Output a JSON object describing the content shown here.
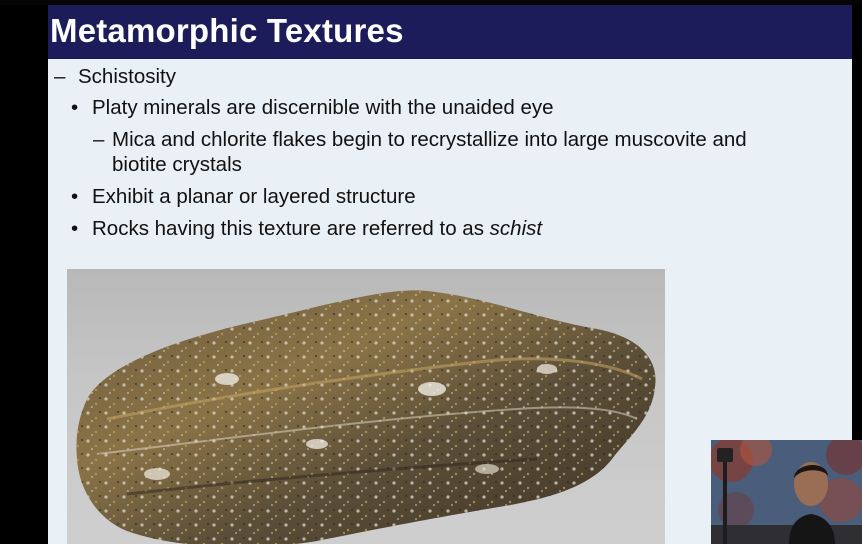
{
  "slide": {
    "title": "Metamorphic Textures",
    "outline": [
      {
        "level": 1,
        "marker": "–",
        "text": "Schistosity"
      },
      {
        "level": 2,
        "marker": "•",
        "text": "Platy minerals are discernible with the unaided eye"
      },
      {
        "level": 3,
        "marker": "–",
        "text": "Mica and chlorite flakes begin to recrystallize into large muscovite and"
      },
      {
        "level": 3,
        "marker": "",
        "text": "biotite crystals"
      },
      {
        "level": 2,
        "marker": "•",
        "text": "Exhibit a planar or layered structure"
      },
      {
        "level": 2,
        "marker": "•",
        "text": "Rocks having this texture are referred to as ",
        "emphasis": "schist"
      }
    ],
    "image_subject": "schist rock sample"
  },
  "webcam": {
    "subject": "presenter webcam feed"
  },
  "colors": {
    "title_bar": "#1c1c5a",
    "slide_background": "#e9f0f6",
    "text": "#111111"
  }
}
